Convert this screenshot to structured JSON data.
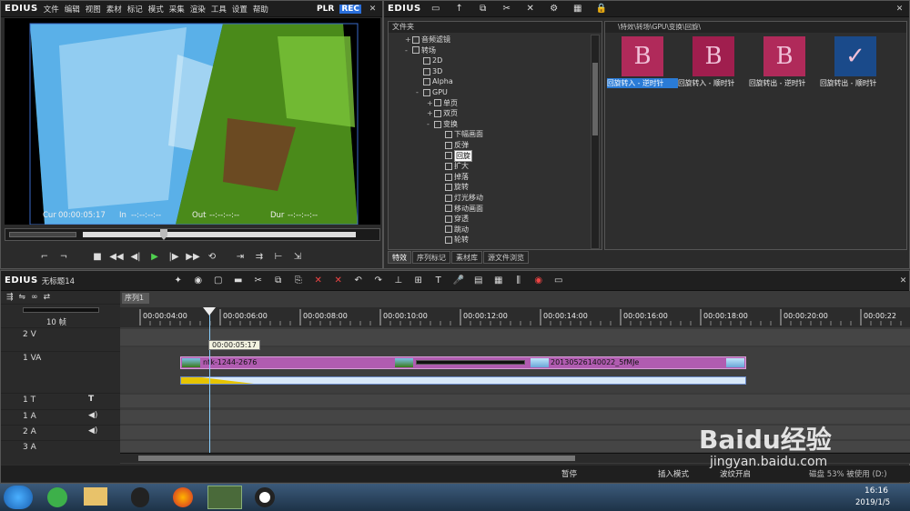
{
  "player": {
    "logo": "EDIUS",
    "menu": [
      "文件",
      "编辑",
      "视图",
      "素材",
      "标记",
      "模式",
      "采集",
      "渲染",
      "工具",
      "设置",
      "帮助"
    ],
    "plr": "PLR",
    "rec": "REC",
    "close": "✕",
    "cur_label": "Cur",
    "cur": "00:00:05:17",
    "in_label": "In",
    "in": "--:--:--:--",
    "out_label": "Out",
    "out": "--:--:--:--",
    "dur_label": "Dur",
    "dur": "--:--:--:--"
  },
  "library": {
    "logo": "EDIUS",
    "folder_header": "文件夹",
    "breadcrumb": "\\特效\\转场\\GPU\\变换\\回旋\\",
    "tree": [
      {
        "label": "音频滤镜",
        "indent": 1,
        "exp": "+",
        "sel": false
      },
      {
        "label": "转场",
        "indent": 1,
        "exp": "-",
        "sel": false
      },
      {
        "label": "2D",
        "indent": 2,
        "exp": "",
        "sel": false
      },
      {
        "label": "3D",
        "indent": 2,
        "exp": "",
        "sel": false
      },
      {
        "label": "Alpha",
        "indent": 2,
        "exp": "",
        "sel": false
      },
      {
        "label": "GPU",
        "indent": 2,
        "exp": "-",
        "sel": false
      },
      {
        "label": "单页",
        "indent": 3,
        "exp": "+",
        "sel": false
      },
      {
        "label": "双页",
        "indent": 3,
        "exp": "+",
        "sel": false
      },
      {
        "label": "变换",
        "indent": 3,
        "exp": "-",
        "sel": false
      },
      {
        "label": "下幅画面",
        "indent": 4,
        "exp": "",
        "sel": false
      },
      {
        "label": "反弹",
        "indent": 4,
        "exp": "",
        "sel": false
      },
      {
        "label": "回旋",
        "indent": 4,
        "exp": "",
        "sel": true
      },
      {
        "label": "扩大",
        "indent": 4,
        "exp": "",
        "sel": false
      },
      {
        "label": "掉落",
        "indent": 4,
        "exp": "",
        "sel": false
      },
      {
        "label": "旋转",
        "indent": 4,
        "exp": "",
        "sel": false
      },
      {
        "label": "灯光移动",
        "indent": 4,
        "exp": "",
        "sel": false
      },
      {
        "label": "移动画面",
        "indent": 4,
        "exp": "",
        "sel": false
      },
      {
        "label": "穿透",
        "indent": 4,
        "exp": "",
        "sel": false
      },
      {
        "label": "跳动",
        "indent": 4,
        "exp": "",
        "sel": false
      },
      {
        "label": "轮转",
        "indent": 4,
        "exp": "",
        "sel": false
      }
    ],
    "effects": [
      {
        "label": "回旋转入 - 逆时针",
        "bg": "#b02a5a",
        "selected": true,
        "letter": "B"
      },
      {
        "label": "回旋转入 - 顺时针",
        "bg": "#a01e4e",
        "selected": false,
        "letter": "B"
      },
      {
        "label": "回旋转出 - 逆时针",
        "bg": "#b02a5a",
        "selected": false,
        "letter": "B"
      },
      {
        "label": "回旋转出 - 顺时针",
        "bg": "#1a4a8a",
        "selected": false,
        "letter": "✓"
      }
    ],
    "tabs": [
      "特效",
      "序列标记",
      "素材库",
      "源文件浏览"
    ],
    "active_tab": 0
  },
  "timeline": {
    "logo": "EDIUS",
    "project": "无标题14",
    "sequence_tab": "序列1",
    "zoom": "10 帧",
    "ruler": [
      "00:00:04:00",
      "00:00:06:00",
      "00:00:08:00",
      "00:00:10:00",
      "00:00:12:00",
      "00:00:14:00",
      "00:00:16:00",
      "00:00:18:00",
      "00:00:20:00",
      "00:00:22"
    ],
    "tooltip": "00:00:05:17",
    "tracks": [
      "2 V",
      "1 VA",
      "1 T",
      "1 A",
      "2 A",
      "3 A"
    ],
    "clip1": "ntk-1244-2676",
    "clip2": "20130526140022_5fMJe",
    "status": {
      "pause": "暂停",
      "insert": "插入模式",
      "ripple": "波纹开启",
      "disk": "磁盘 53% 被使用 (D:)"
    }
  },
  "taskbar": {
    "time": "16:16",
    "date": "2019/1/5"
  },
  "watermark": {
    "text": "Baidu经验",
    "url": "jingyan.baidu.com"
  }
}
